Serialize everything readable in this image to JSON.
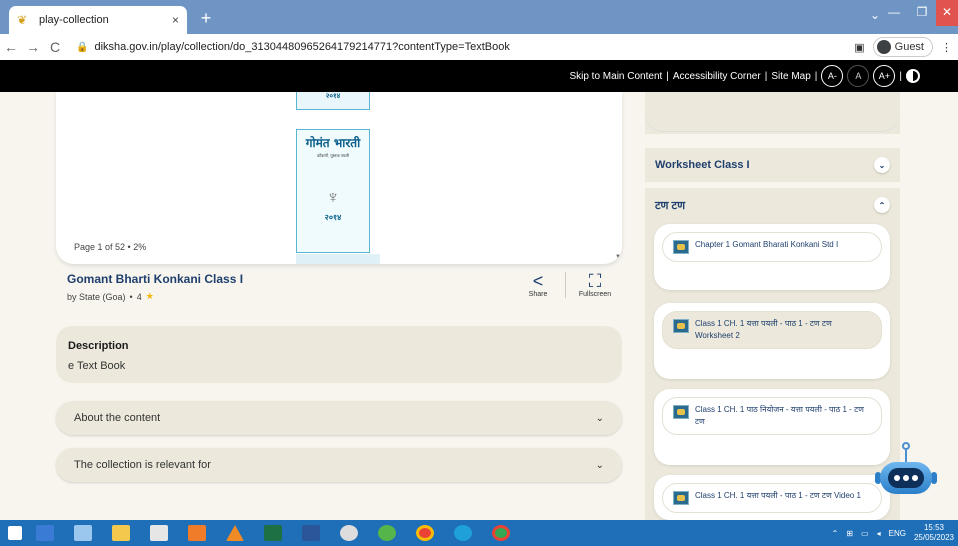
{
  "browser": {
    "tab_title": "play-collection",
    "tab_close": "×",
    "new_tab": "+",
    "url": "diksha.gov.in/play/collection/do_31304480965264179214771?contentType=TextBook",
    "guest_label": "Guest"
  },
  "a11y_bar": {
    "skip": "Skip to Main Content",
    "sep1": "|",
    "corner": "Accessibility Corner",
    "sep2": "|",
    "sitemap": "Site Map",
    "sep3": "|",
    "font_minus": "A-",
    "font_normal": "A",
    "font_plus": "A+",
    "sep4": "|"
  },
  "viewer": {
    "book_title": "गोमंत भारती",
    "book_subtitle": "कोंकणी, पुस्तक पयली",
    "book_year": "२०१४",
    "page_info": "Page 1 of 52 • 2%"
  },
  "content": {
    "title": "Gomant Bharti Konkani Class I",
    "by": "by State (Goa)",
    "dot": "•",
    "rating": "4",
    "share_label": "Share",
    "fullscreen_label": "Fullscreen",
    "description_heading": "Description",
    "description_text": "e Text Book",
    "about_label": "About the content",
    "relevant_label": "The collection is relevant for"
  },
  "right_panel": {
    "worksheet_label": "Worksheet Class I",
    "section_label": "टण टण",
    "items": [
      {
        "label": "Chapter 1 Gomant Bharati Konkani Std I"
      },
      {
        "label": "Class 1 CH. 1 यत्ता पयली - पाठ 1 - टण टण Worksheet 2"
      },
      {
        "label": "Class 1 CH. 1 पाठ नियोजन - यत्ता पयली - पाठ 1 - टण टण"
      },
      {
        "label": "Class 1 CH. 1 यत्ता पयली - पाठ 1 - टण टण Video 1"
      }
    ]
  },
  "taskbar": {
    "lang": "ENG",
    "time": "15:53",
    "date": "25/05/2023"
  },
  "colors": {
    "accent": "#1f3f6e",
    "panel": "#ece9dc",
    "taskbar": "#1e6fb7",
    "tabbar": "#6f95c4"
  }
}
